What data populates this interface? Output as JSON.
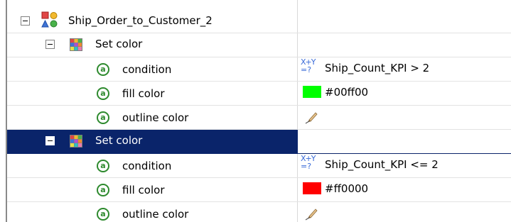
{
  "tree": {
    "root": {
      "label": "Ship_Order_to_Customer_2",
      "icon": "process-shapes-icon"
    },
    "groups": [
      {
        "label": "Set color",
        "icon": "palette-icon",
        "selected": false,
        "properties": [
          {
            "name": "condition",
            "value": "Ship_Count_KPI > 2",
            "value_icon": "expression-icon",
            "expr_top": "X+Y",
            "expr_bottom": "=?"
          },
          {
            "name": "fill color",
            "value": "#00ff00",
            "swatch_color": "#00ff00"
          },
          {
            "name": "outline color",
            "value": "",
            "value_icon": "pencil-brush-icon"
          }
        ]
      },
      {
        "label": "Set color",
        "icon": "palette-icon",
        "selected": true,
        "properties": [
          {
            "name": "condition",
            "value": "Ship_Count_KPI <= 2",
            "value_icon": "expression-icon",
            "expr_top": "X+Y",
            "expr_bottom": "=?"
          },
          {
            "name": "fill color",
            "value": "#ff0000",
            "swatch_color": "#ff0000"
          },
          {
            "name": "outline color",
            "value": "",
            "value_icon": "pencil-brush-icon"
          }
        ]
      }
    ],
    "attribute_icon_glyph": "a"
  },
  "colors": {
    "selection_bg": "#0a246a",
    "attribute_icon": "#2e8a2e",
    "expression_icon": "#3a6bd8"
  }
}
